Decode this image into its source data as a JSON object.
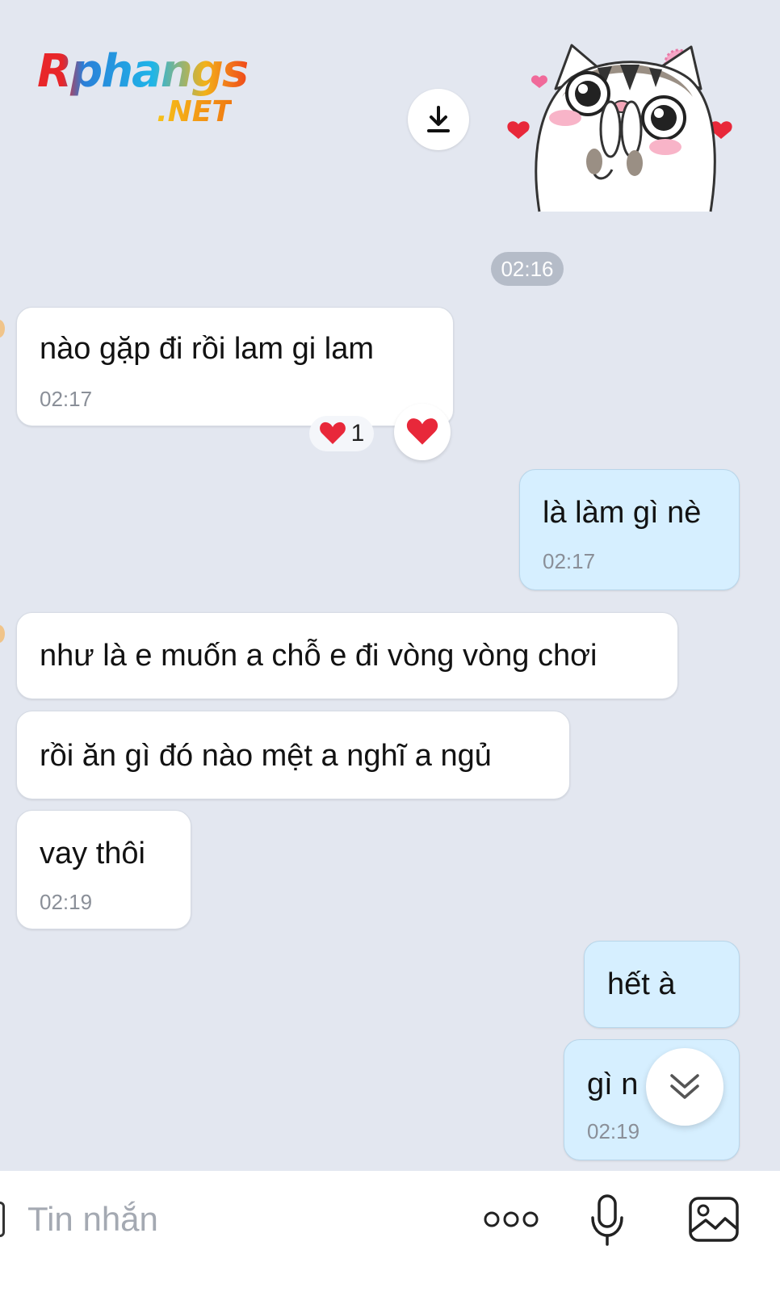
{
  "watermark": {
    "main": "Rphangs",
    "sub": ".NET"
  },
  "time_separator": "02:16",
  "messages": [
    {
      "side": "in",
      "text": "nào gặp  đi rồi lam gi lam",
      "time": "02:17"
    },
    {
      "side": "out",
      "text": "là làm gì nè",
      "time": "02:17"
    },
    {
      "side": "in",
      "text": "như là e muốn a chỗ e đi vòng vòng chơi",
      "time": ""
    },
    {
      "side": "in",
      "text": "rồi ăn gì đó nào mệt a nghĩ a ngủ",
      "time": ""
    },
    {
      "side": "in",
      "text": "vay thôi",
      "time": "02:19"
    },
    {
      "side": "out",
      "text": "hết à",
      "time": ""
    },
    {
      "side": "out",
      "text": "gì n",
      "time": "02:19"
    }
  ],
  "reaction": {
    "count": "1",
    "icon": "heart-icon"
  },
  "composer": {
    "placeholder": "Tin nhắn",
    "icons": [
      "more-icon",
      "microphone-icon",
      "image-icon"
    ]
  },
  "colors": {
    "background": "#e3e7f0",
    "incoming_bubble": "#ffffff",
    "outgoing_bubble": "#d6efff",
    "heart": "#e8283a"
  }
}
